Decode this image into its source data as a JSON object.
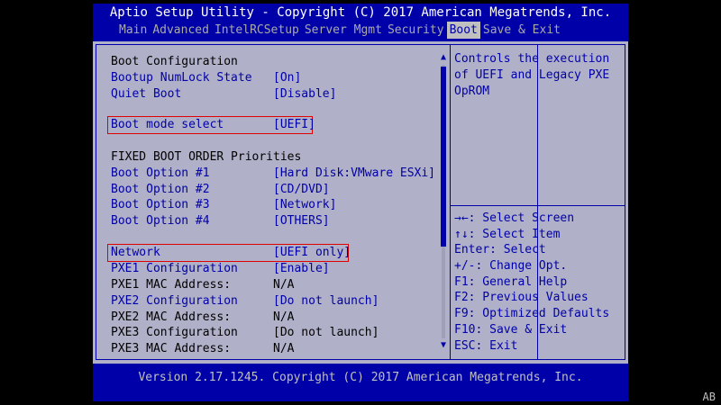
{
  "header": {
    "title": "Aptio Setup Utility - Copyright (C) 2017 American Megatrends, Inc."
  },
  "menu": {
    "tabs": [
      "Main",
      "Advanced",
      "IntelRCSetup",
      "Server Mgmt",
      "Security",
      "Boot",
      "Save & Exit"
    ],
    "active": "Boot"
  },
  "settings": {
    "section1": "Boot Configuration",
    "numlock": {
      "label": "Bootup NumLock State",
      "value": "[On]"
    },
    "quiet": {
      "label": "Quiet Boot",
      "value": "[Disable]"
    },
    "bootmode": {
      "label": "Boot mode select",
      "value": "[UEFI]"
    },
    "section2": "FIXED BOOT ORDER Priorities",
    "opt1": {
      "label": "Boot Option #1",
      "value": "[Hard Disk:VMware ESXi]"
    },
    "opt2": {
      "label": "Boot Option #2",
      "value": "[CD/DVD]"
    },
    "opt3": {
      "label": "Boot Option #3",
      "value": "[Network]"
    },
    "opt4": {
      "label": "Boot Option #4",
      "value": "[OTHERS]"
    },
    "network": {
      "label": "Network",
      "value": "[UEFI only]"
    },
    "pxe1cfg": {
      "label": "PXE1 Configuration",
      "value": "[Enable]"
    },
    "pxe1mac": {
      "label": "PXE1 MAC Address:",
      "value": "N/A"
    },
    "pxe2cfg": {
      "label": "PXE2 Configuration",
      "value": "[Do not launch]"
    },
    "pxe2mac": {
      "label": "PXE2 MAC Address:",
      "value": "N/A"
    },
    "pxe3cfg": {
      "label": "PXE3 Configuration",
      "value": "[Do not launch]"
    },
    "pxe3mac": {
      "label": "PXE3 MAC Address:",
      "value": "N/A"
    }
  },
  "scroll": {
    "up": "▲",
    "down": "▼"
  },
  "help": {
    "text": "Controls the execution of UEFI and Legacy PXE OpROM"
  },
  "keys": [
    "→←: Select Screen",
    "↑↓: Select Item",
    "Enter: Select",
    "+/-: Change Opt.",
    "F1: General Help",
    "F2: Previous Values",
    "F9: Optimized Defaults",
    "F10: Save & Exit",
    "ESC: Exit"
  ],
  "footer": {
    "version": "Version 2.17.1245. Copyright (C) 2017 American Megatrends, Inc."
  },
  "badge": "AB",
  "colors": {
    "background": "#0000a8",
    "panel": "#b0b0c8",
    "highlight_border": "#e00000",
    "link": "#0000a8"
  }
}
